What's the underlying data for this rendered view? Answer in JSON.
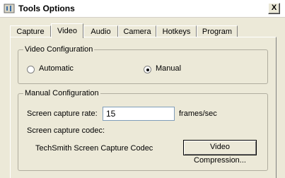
{
  "window": {
    "title": "Tools Options",
    "close_label": "X"
  },
  "tabs": [
    {
      "label": "Capture"
    },
    {
      "label": "Video",
      "selected": true
    },
    {
      "label": "Audio"
    },
    {
      "label": "Camera"
    },
    {
      "label": "Hotkeys"
    },
    {
      "label": "Program"
    }
  ],
  "video_config": {
    "title": "Video Configuration",
    "automatic_label": "Automatic",
    "manual_label": "Manual",
    "selected": "Manual"
  },
  "manual_config": {
    "title": "Manual Configuration",
    "rate_label": "Screen capture rate:",
    "rate_value": "15",
    "rate_unit": "frames/sec",
    "codec_label": "Screen capture codec:",
    "codec_name": "TechSmith Screen Capture Codec",
    "compression_button": "Video Compression..."
  },
  "icons": {
    "app": "app-icon",
    "close": "close-icon"
  }
}
